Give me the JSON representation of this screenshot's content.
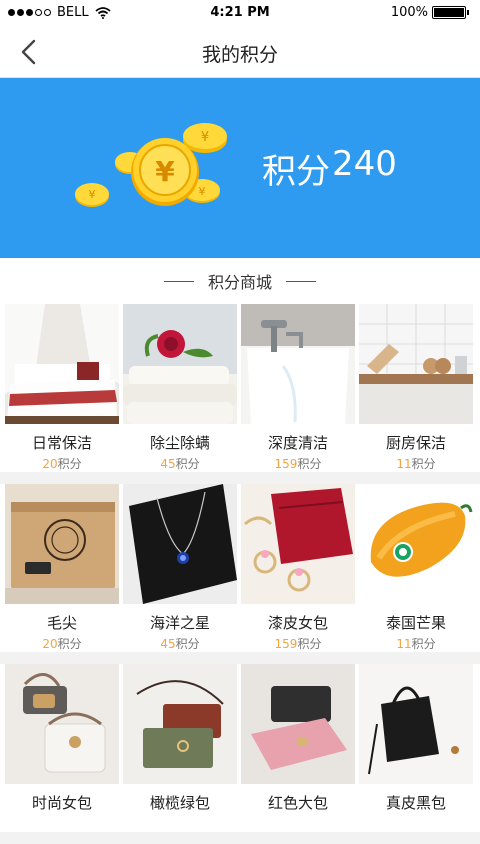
{
  "status_bar": {
    "carrier": "BELL",
    "time": "4:21 PM",
    "battery": "100%"
  },
  "nav": {
    "title": "我的积分",
    "back_icon": "chevron-left-icon"
  },
  "banner": {
    "points_label": "积分",
    "points_value": "240",
    "bg_color": "#2e9bf0"
  },
  "section": {
    "title": "积分商城"
  },
  "price_unit": "积分",
  "rows": [
    [
      {
        "name": "日常保洁",
        "price": "20"
      },
      {
        "name": "除尘除螨",
        "price": "45"
      },
      {
        "name": "深度清洁",
        "price": "159"
      },
      {
        "name": "厨房保洁",
        "price": "11"
      }
    ],
    [
      {
        "name": "毛尖",
        "price": "20"
      },
      {
        "name": "海洋之星",
        "price": "45"
      },
      {
        "name": "漆皮女包",
        "price": "159"
      },
      {
        "name": "泰国芒果",
        "price": "11"
      }
    ],
    [
      {
        "name": "时尚女包",
        "price": ""
      },
      {
        "name": "橄榄绿包",
        "price": ""
      },
      {
        "name": "红色大包",
        "price": ""
      },
      {
        "name": "真皮黑包",
        "price": ""
      }
    ]
  ]
}
